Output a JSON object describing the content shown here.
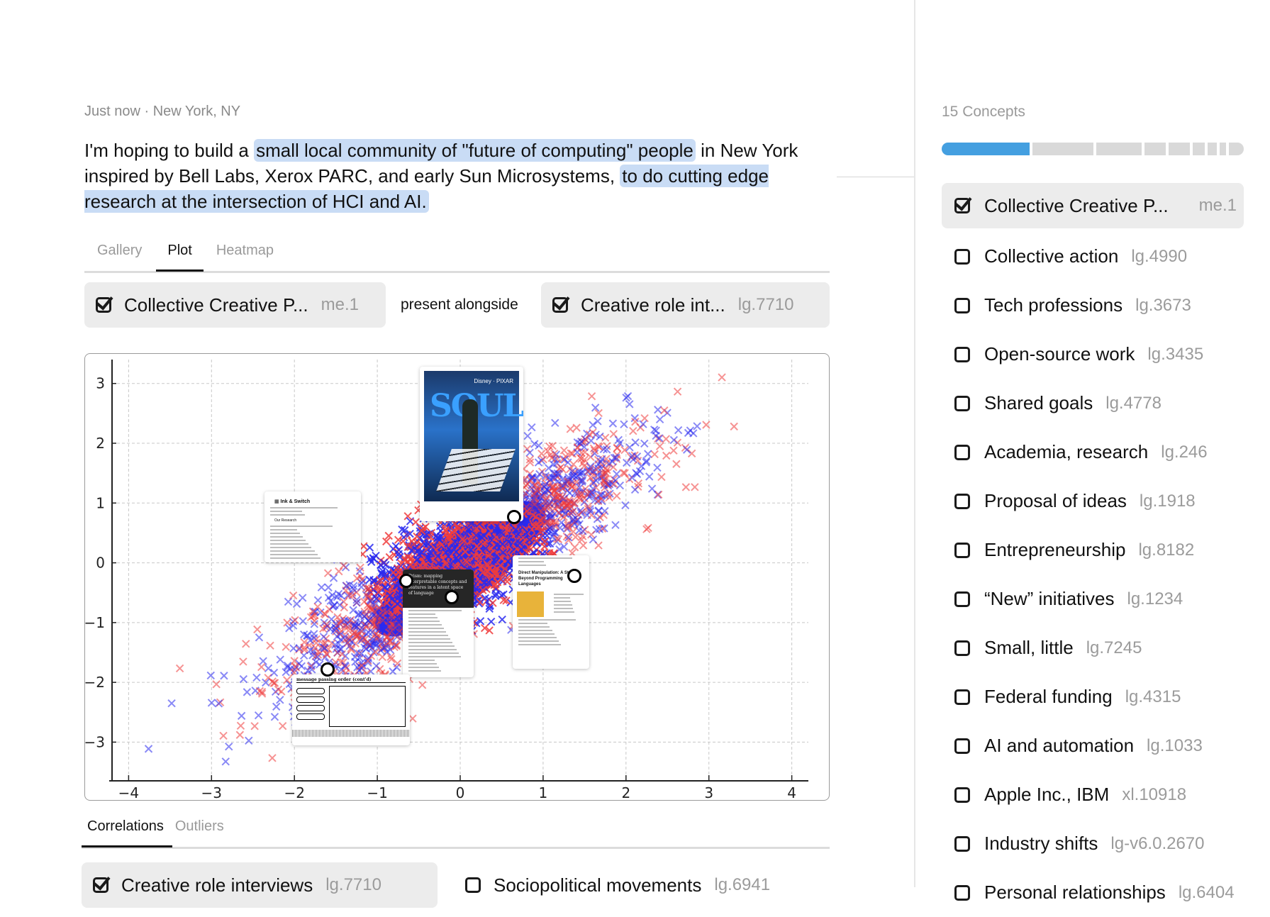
{
  "meta": {
    "text": "Just now · New York, NY"
  },
  "prompt": {
    "segments": [
      {
        "text": "I'm hoping to build a ",
        "highlight": false
      },
      {
        "text": "small local community of \"future of computing\" people",
        "highlight": true
      },
      {
        "text": " in New York inspired by Bell Labs, Xerox PARC, and early Sun Microsystems, ",
        "highlight": false
      },
      {
        "text": "to do cutting edge research at the intersection of HCI and AI.",
        "highlight": true
      }
    ]
  },
  "view_tabs": [
    {
      "label": "Gallery",
      "active": false
    },
    {
      "label": "Plot",
      "active": true
    },
    {
      "label": "Heatmap",
      "active": false
    }
  ],
  "comparison": {
    "left": {
      "label": "Collective Creative P...",
      "code": "me.1",
      "checked": true
    },
    "relation": "present alongside",
    "right": {
      "label": "Creative role int...",
      "code": "lg.7710",
      "checked": true
    }
  },
  "colors": {
    "highlight": "#c9dcf5",
    "accent": "#449fe0",
    "series_blue": "#2a2af0",
    "series_red": "#f03c3c"
  },
  "chart_data": {
    "type": "scatter",
    "title": "",
    "xlabel": "",
    "ylabel": "",
    "xlim": [
      -4.2,
      4.2
    ],
    "ylim": [
      -3.6,
      3.4
    ],
    "xticks": [
      "−4",
      "−3",
      "−2",
      "−1",
      "0",
      "1",
      "2",
      "3",
      "4"
    ],
    "xtick_values": [
      -4,
      -3,
      -2,
      -1,
      0,
      1,
      2,
      3,
      4
    ],
    "yticks": [
      "3",
      "2",
      "1",
      "0",
      "−1",
      "−2",
      "−3"
    ],
    "ytick_values": [
      3,
      2,
      1,
      0,
      -1,
      -2,
      -3
    ],
    "grid": true,
    "marker": "x",
    "correlation_approx": 0.85,
    "series": [
      {
        "name": "Collective Creative P...",
        "color": "#f03c3c",
        "approx_count": 2000,
        "x_mean": 0,
        "x_std": 1,
        "y_mean": 0,
        "y_std": 1
      },
      {
        "name": "Creative role int...",
        "color": "#2a2af0",
        "approx_count": 2000,
        "x_mean": 0,
        "x_std": 1,
        "y_mean": 0,
        "y_std": 1
      }
    ],
    "dense_region": {
      "x": [
        -1.2,
        1.1
      ],
      "y": [
        -1.6,
        1.0
      ]
    },
    "annotations": [
      {
        "name": "soul-poster",
        "kind": "movie-poster",
        "title": "SOUL",
        "subtitle": "Disney · PIXAR",
        "anchor": [
          0.65,
          0.77
        ]
      },
      {
        "name": "ink-and-switch-page",
        "kind": "webpage",
        "title": "Ink & Switch",
        "section": "Our Research",
        "anchor": [
          -0.65,
          -0.3
        ]
      },
      {
        "name": "prism-article",
        "kind": "article",
        "title": "Prism: mapping interpretable concepts and features in a latent space of language",
        "anchor": [
          -0.1,
          -0.57
        ]
      },
      {
        "name": "direct-manipulation-paper",
        "kind": "paper",
        "title": "Direct Manipulation: A Step Beyond Programming Languages",
        "anchor": [
          1.38,
          -0.22
        ]
      },
      {
        "name": "hypercard-screenshot",
        "kind": "software-screenshot",
        "title": "message passing order (cont'd)",
        "anchor": [
          -1.6,
          -1.78
        ]
      }
    ]
  },
  "result_tabs": [
    {
      "label": "Correlations",
      "active": true
    },
    {
      "label": "Outliers",
      "active": false
    }
  ],
  "results": [
    {
      "label": "Creative role interviews",
      "code": "lg.7710",
      "checked": true
    },
    {
      "label": "Sociopolitical movements",
      "code": "lg.6941",
      "checked": false
    }
  ],
  "concepts": {
    "title": "15 Concepts",
    "bar_segments": [
      0.29,
      0.2,
      0.15,
      0.07,
      0.07,
      0.04,
      0.03,
      0.02,
      0.05
    ],
    "items": [
      {
        "label": "Collective Creative P...",
        "code": "me.1",
        "checked": true,
        "selected": true
      },
      {
        "label": "Collective action",
        "code": "lg.4990",
        "checked": false
      },
      {
        "label": "Tech professions",
        "code": "lg.3673",
        "checked": false
      },
      {
        "label": "Open-source work",
        "code": "lg.3435",
        "checked": false
      },
      {
        "label": "Shared goals",
        "code": "lg.4778",
        "checked": false
      },
      {
        "label": "Academia, research",
        "code": "lg.246",
        "checked": false
      },
      {
        "label": "Proposal of ideas",
        "code": "lg.1918",
        "checked": false
      },
      {
        "label": "Entrepreneurship",
        "code": "lg.8182",
        "checked": false
      },
      {
        "label": "“New” initiatives",
        "code": "lg.1234",
        "checked": false
      },
      {
        "label": "Small, little",
        "code": "lg.7245",
        "checked": false
      },
      {
        "label": "Federal funding",
        "code": "lg.4315",
        "checked": false
      },
      {
        "label": "AI and automation",
        "code": "lg.1033",
        "checked": false
      },
      {
        "label": "Apple Inc., IBM",
        "code": "xl.10918",
        "checked": false
      },
      {
        "label": "Industry shifts",
        "code": "lg-v6.0.2670",
        "checked": false
      },
      {
        "label": "Personal relationships",
        "code": "lg.6404",
        "checked": false
      }
    ]
  }
}
